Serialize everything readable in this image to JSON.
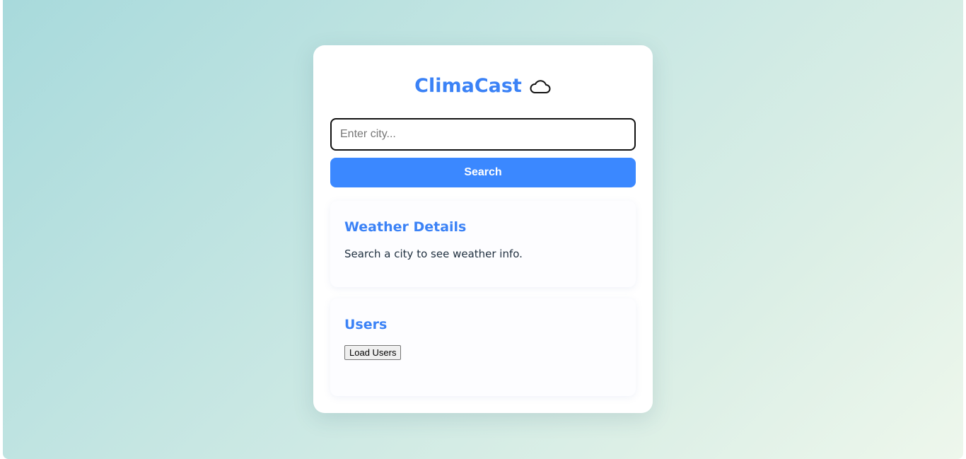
{
  "app": {
    "title": "ClimaCast",
    "title_icon": "cloud-icon"
  },
  "search": {
    "placeholder": "Enter city...",
    "value": "",
    "button_label": "Search"
  },
  "weather_panel": {
    "heading": "Weather Details",
    "message": "Search a city to see weather info."
  },
  "users_panel": {
    "heading": "Users",
    "button_label": "Load Users"
  },
  "colors": {
    "accent": "#3b82f6",
    "button": "#3b88ff",
    "background_start": "#a8dadc",
    "background_end": "#eef7ec"
  }
}
